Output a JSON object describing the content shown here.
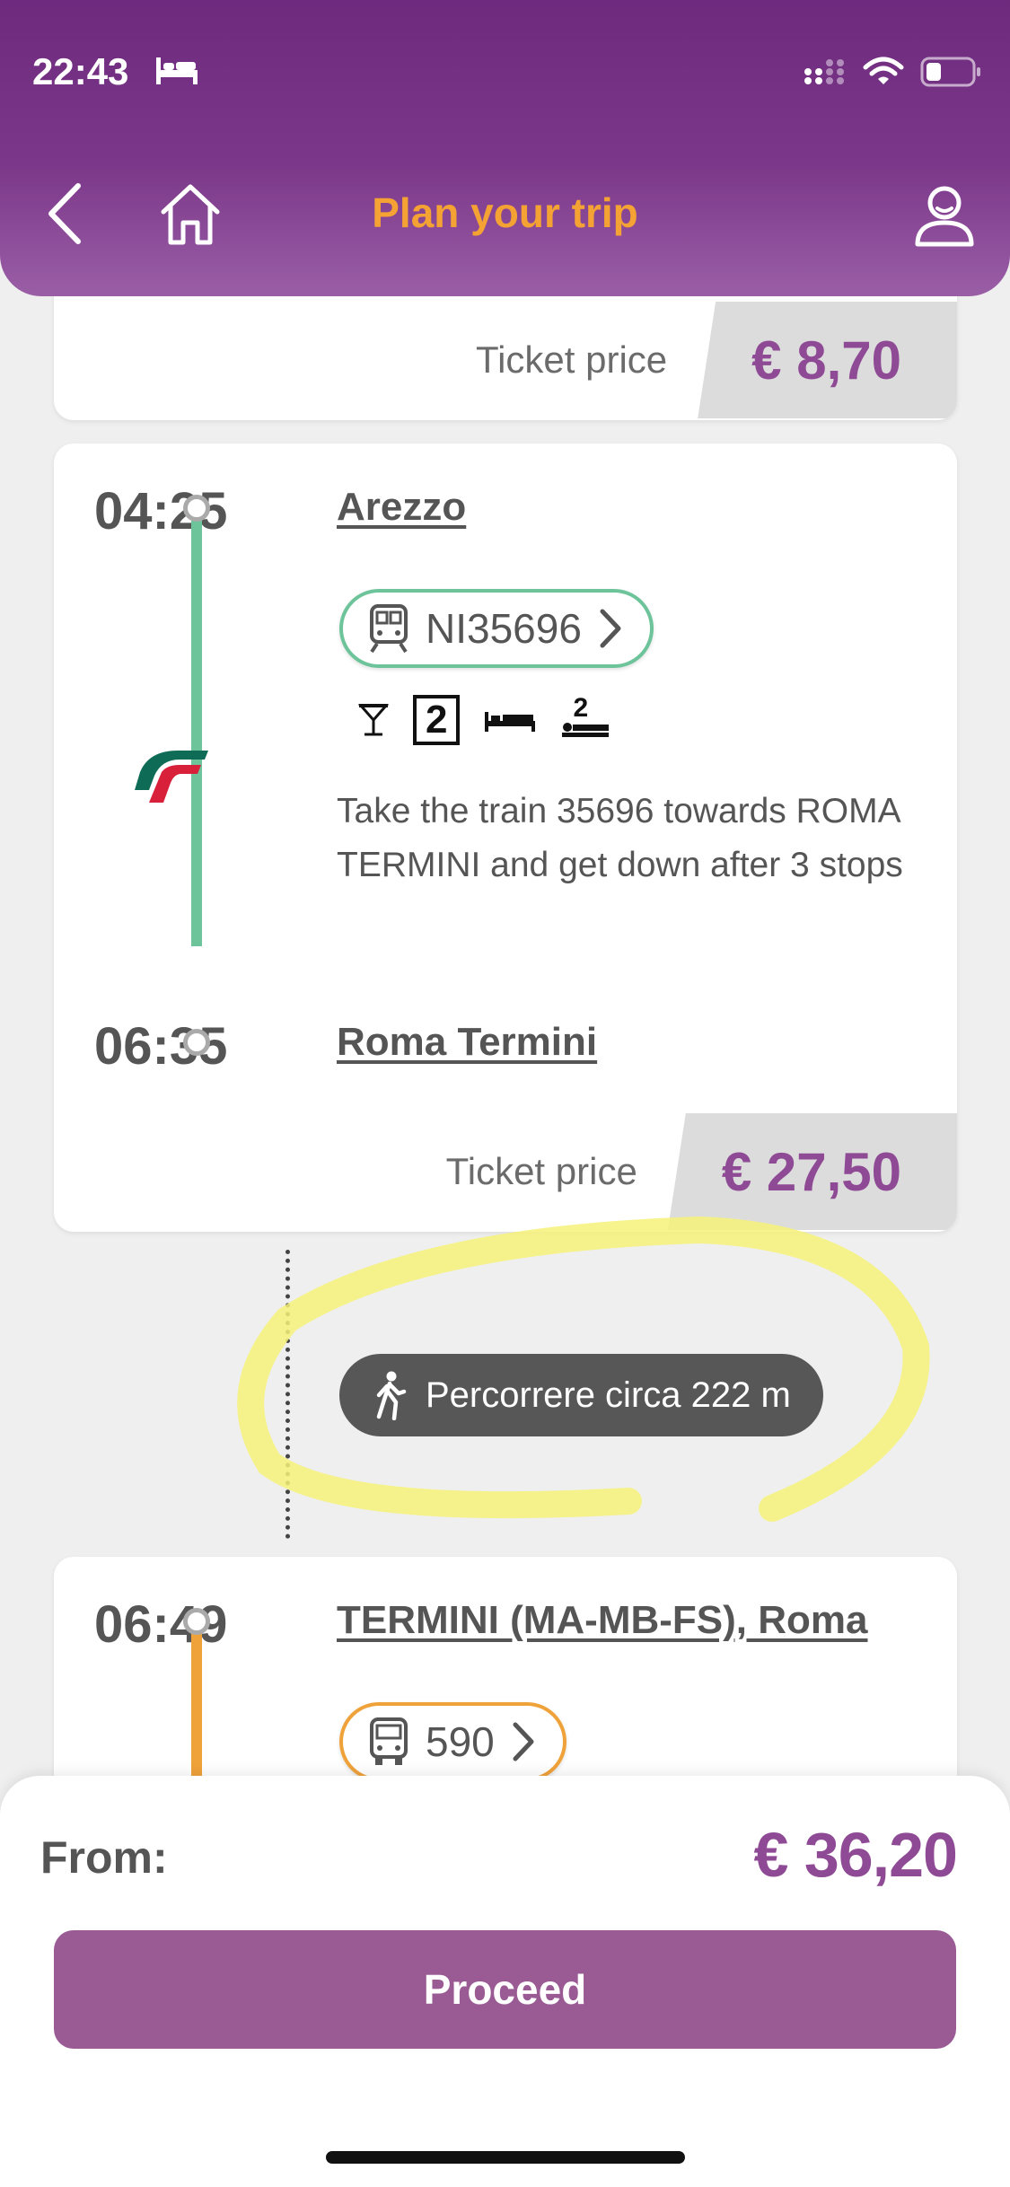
{
  "status_bar": {
    "time": "22:43"
  },
  "header": {
    "title": "Plan your trip"
  },
  "first_card": {
    "price_label": "Ticket price",
    "price": "€ 8,70"
  },
  "train_card": {
    "departure_time": "04:25",
    "departure_stop": "Arezzo",
    "train_code": "NI35696",
    "amenity_class": "2",
    "amenity_class_couchette": "2",
    "instructions": "Take the train 35696 towards ROMA TERMINI and get down after 3 stops",
    "arrival_time": "06:35",
    "arrival_stop": "Roma Termini",
    "price_label": "Ticket price",
    "price": "€ 27,50",
    "line_color": "#6dc49a"
  },
  "walk_segment": {
    "text": "Percorrere circa 222 m"
  },
  "bus_card": {
    "departure_time": "06:49",
    "departure_stop": "TERMINI (MA-MB-FS), Roma",
    "bus_code": "590",
    "line_color": "#f0a23a"
  },
  "footer": {
    "from_label": "From:",
    "total_price": "€ 36,20",
    "proceed_label": "Proceed"
  },
  "colors": {
    "header": "#6e2a7d",
    "title_accent": "#f4a234",
    "price": "#8e4a94",
    "button": "#9a5b94"
  }
}
